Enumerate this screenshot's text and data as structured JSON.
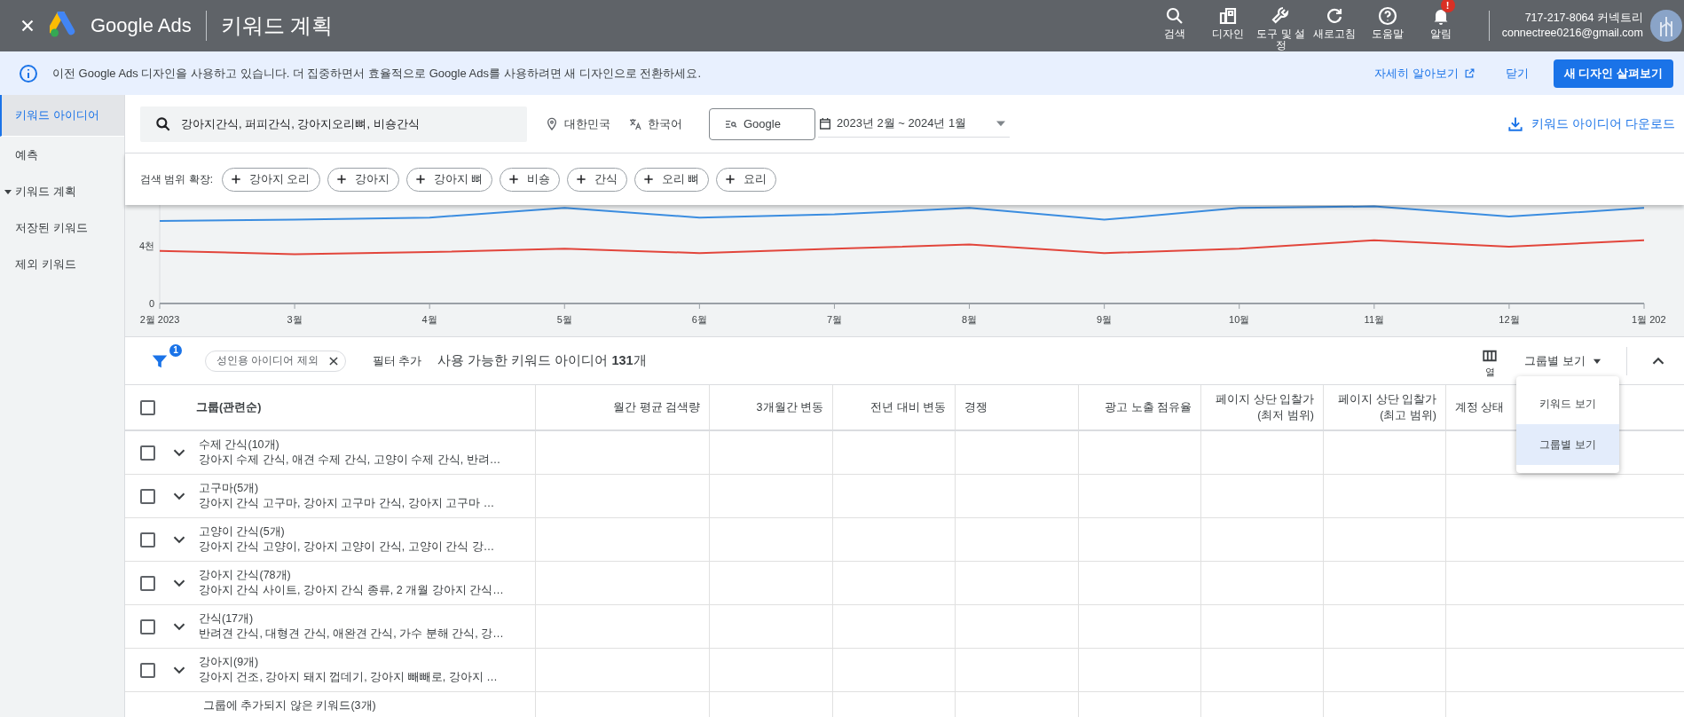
{
  "top_bar": {
    "product": "Google Ads",
    "page_title": "키워드 계획",
    "actions": [
      {
        "label": "검색"
      },
      {
        "label": "디자인"
      },
      {
        "label": "도구 및 설정"
      },
      {
        "label": "새로고침"
      },
      {
        "label": "도움말"
      },
      {
        "label": "알림",
        "badge": "!"
      }
    ],
    "account": {
      "name": "717-217-8064 커넥트리",
      "email": "connectree0216@gmail.com"
    }
  },
  "banner": {
    "message": "이전 Google Ads 디자인을 사용하고 있습니다. 더 집중하면서 효율적으로 Google Ads를 사용하려면 새 디자인으로 전환하세요.",
    "learn_more": "자세히 알아보기",
    "dismiss": "닫기",
    "primary": "새 디자인 살펴보기"
  },
  "sidebar": {
    "items": [
      {
        "label": "키워드 아이디어",
        "kind": "link",
        "selected": true
      },
      {
        "label": "예측",
        "kind": "link",
        "selected": false
      },
      {
        "label": "키워드 계획",
        "kind": "group",
        "expanded": true,
        "selected": false
      },
      {
        "label": "저장된 키워드",
        "kind": "link",
        "selected": false
      },
      {
        "label": "제외 키워드",
        "kind": "link",
        "selected": false
      }
    ]
  },
  "search": {
    "query": "강아지간식, 퍼피간식, 강아지오리뼈, 비숑간식",
    "location": "대한민국",
    "language": "한국어",
    "network": "Google",
    "date_range": "2023년 2월 ~ 2024년 1월",
    "download": "키워드 아이디어 다운로드"
  },
  "broaden": {
    "label": "검색 범위 확장:",
    "chips": [
      "강아지 오리",
      "강아지",
      "강아지 뼈",
      "비숑",
      "간식",
      "오리 뼈",
      "요리"
    ]
  },
  "trend": {
    "chart_data": {
      "type": "line",
      "categories": [
        "2월 2023",
        "3월",
        "4월",
        "5월",
        "6월",
        "7월",
        "8월",
        "9월",
        "10월",
        "11월",
        "12월",
        "1월 202"
      ],
      "series": [
        {
          "color": "#3b8de0",
          "values": [
            5.7,
            5.78,
            5.93,
            6.6,
            5.93,
            6.15,
            6.6,
            5.78,
            6.6,
            6.7,
            6.0,
            6.6
          ]
        },
        {
          "color": "#e2453b",
          "values": [
            3.63,
            3.4,
            3.55,
            3.78,
            3.48,
            3.78,
            4.07,
            3.48,
            3.78,
            4.37,
            3.92,
            4.37
          ]
        }
      ],
      "ylim": [
        0,
        6.8
      ],
      "yticks": [
        {
          "value": 0,
          "label": "0"
        },
        {
          "value": 4,
          "label": "4천"
        }
      ]
    }
  },
  "filters": {
    "count_badge": "1",
    "chips": [
      "성인용 아이디어 제외"
    ],
    "add_filter": "필터 추가",
    "summary": "사용 가능한 키워드 아이디어 **131**개",
    "columns_label": "열",
    "view": "그룹별 보기"
  },
  "view_menu": [
    {
      "label": "키워드 보기",
      "selected": false
    },
    {
      "label": "그룹별 보기",
      "selected": true
    }
  ],
  "table": {
    "select_all_checked": false,
    "columns": [
      {
        "label": "그룹(관련순)"
      },
      {
        "label": "월간 평균 검색량"
      },
      {
        "label": "3개월간 변동"
      },
      {
        "label": "전년 대비 변동"
      },
      {
        "label": "경쟁"
      },
      {
        "label": "광고 노출 점유율"
      },
      {
        "label": "페이지 상단 입찰가 (최저 범위)"
      },
      {
        "label": "페이지 상단 입찰가 (최고 범위)"
      },
      {
        "label": "계정 상태"
      }
    ],
    "rows": [
      {
        "group": "수제 간식(10개)",
        "keywords": "강아지 수제 간식, 애견 수제 간식, 고양이 수제 간식, 반려…",
        "checked": false,
        "expanded": false
      },
      {
        "group": "고구마(5개)",
        "keywords": "강아지 간식 고구마, 강아지 고구마 간식, 강아지 고구마 …",
        "checked": false,
        "expanded": false
      },
      {
        "group": "고양이 간식(5개)",
        "keywords": "강아지 간식 고양이, 강아지 고양이 간식, 고양이 간식 강…",
        "checked": false,
        "expanded": false
      },
      {
        "group": "강아지 간식(78개)",
        "keywords": "강아지 간식 사이트, 강아지 간식 종류, 2 개월 강아지 간식…",
        "checked": false,
        "expanded": false
      },
      {
        "group": "간식(17개)",
        "keywords": "반려견 간식, 대형견 간식, 애완견 간식, 가수 분해 간식, 강…",
        "checked": false,
        "expanded": false
      },
      {
        "group": "강아지(9개)",
        "keywords": "강아지 건조, 강아지 돼지 껍데기, 강아지 빼빼로, 강아지 …",
        "checked": false,
        "expanded": false
      },
      {
        "group": "그룹에 추가되지 않은 키워드(3개)"
      }
    ]
  }
}
